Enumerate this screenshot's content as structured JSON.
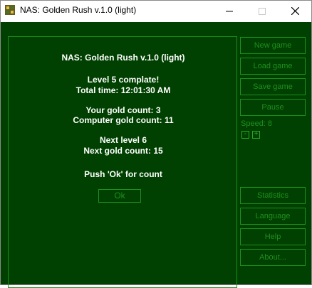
{
  "window": {
    "title": "NAS: Golden Rush v.1.0 (light)",
    "controls": {
      "minimize": "—",
      "maximize": "☐",
      "close": "✕"
    }
  },
  "message": {
    "title": "NAS: Golden Rush v.1.0 (light)",
    "level_complete": "Level 5 complate!",
    "total_time": "Total time: 12:01:30 AM",
    "your_gold": "Your gold count: 3",
    "computer_gold": "Computer gold count: 11",
    "next_level": "Next level 6",
    "next_gold": "Next gold count: 15",
    "push_ok": "Push 'Ok' for count",
    "ok_button": "Ok"
  },
  "sidebar": {
    "new_game": "New game",
    "load_game": "Load game",
    "save_game": "Save game",
    "pause": "Pause",
    "speed_label": "Speed: 8",
    "speed_minus": "-",
    "speed_plus": "+",
    "statistics": "Statistics",
    "language": "Language",
    "help": "Help",
    "about": "About..."
  },
  "colors": {
    "background": "#004000",
    "accent": "#1f8f1f",
    "text": "#ffffff"
  }
}
